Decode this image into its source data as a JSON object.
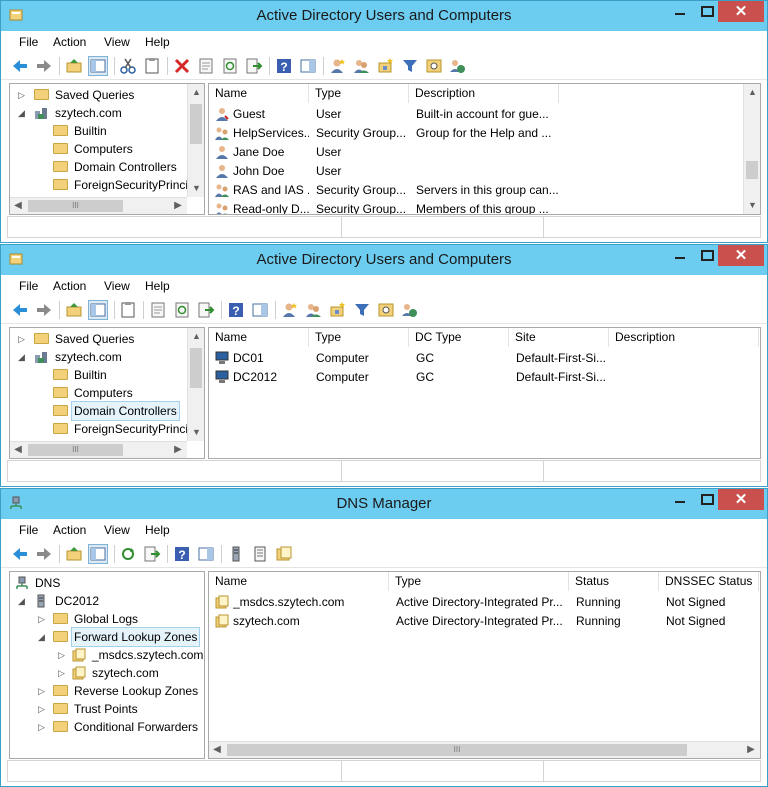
{
  "windows": [
    {
      "title": "Active Directory Users and Computers",
      "menu": [
        "File",
        "Action",
        "View",
        "Help"
      ],
      "tree": [
        {
          "label": "Saved Queries",
          "expander": "▷",
          "level": 1
        },
        {
          "label": "szytech.com",
          "expander": "◢",
          "level": 1
        },
        {
          "label": "Builtin",
          "expander": "",
          "level": 2
        },
        {
          "label": "Computers",
          "expander": "",
          "level": 2
        },
        {
          "label": "Domain Controllers",
          "expander": "",
          "level": 2
        },
        {
          "label": "ForeignSecurityPrinci",
          "expander": "",
          "level": 2
        }
      ],
      "columns": [
        "Name",
        "Type",
        "Description"
      ],
      "rows": [
        [
          "Guest",
          "User",
          "Built-in account for gue..."
        ],
        [
          "HelpServices...",
          "Security Group...",
          "Group for the Help and ..."
        ],
        [
          "Jane Doe",
          "User",
          ""
        ],
        [
          "John Doe",
          "User",
          ""
        ],
        [
          "RAS and IAS ...",
          "Security Group...",
          "Servers in this group can..."
        ],
        [
          "Read-only D...",
          "Security Group...",
          "Members of this group ..."
        ]
      ]
    },
    {
      "title": "Active Directory Users and Computers",
      "menu": [
        "File",
        "Action",
        "View",
        "Help"
      ],
      "tree": [
        {
          "label": "Saved Queries",
          "expander": "▷",
          "level": 1
        },
        {
          "label": "szytech.com",
          "expander": "◢",
          "level": 1
        },
        {
          "label": "Builtin",
          "expander": "",
          "level": 2
        },
        {
          "label": "Computers",
          "expander": "",
          "level": 2
        },
        {
          "label": "Domain Controllers",
          "expander": "",
          "level": 2
        },
        {
          "label": "ForeignSecurityPrinci",
          "expander": "",
          "level": 2
        }
      ],
      "columns": [
        "Name",
        "Type",
        "DC Type",
        "Site",
        "Description"
      ],
      "rows": [
        [
          "DC01",
          "Computer",
          "GC",
          "Default-First-Si...",
          ""
        ],
        [
          "DC2012",
          "Computer",
          "GC",
          "Default-First-Si...",
          ""
        ]
      ]
    },
    {
      "title": "DNS Manager",
      "menu": [
        "File",
        "Action",
        "View",
        "Help"
      ],
      "tree": [
        {
          "label": "DNS",
          "expander": "",
          "level": 0
        },
        {
          "label": "DC2012",
          "expander": "◢",
          "level": 1
        },
        {
          "label": "Global Logs",
          "expander": "▷",
          "level": 2
        },
        {
          "label": "Forward Lookup Zones",
          "expander": "◢",
          "level": 2
        },
        {
          "label": "_msdcs.szytech.com",
          "expander": "▷",
          "level": 3
        },
        {
          "label": "szytech.com",
          "expander": "▷",
          "level": 3
        },
        {
          "label": "Reverse Lookup Zones",
          "expander": "▷",
          "level": 2
        },
        {
          "label": "Trust Points",
          "expander": "▷",
          "level": 2
        },
        {
          "label": "Conditional Forwarders",
          "expander": "▷",
          "level": 2
        }
      ],
      "columns": [
        "Name",
        "Type",
        "Status",
        "DNSSEC Status"
      ],
      "rows": [
        [
          "_msdcs.szytech.com",
          "Active Directory-Integrated Pr...",
          "Running",
          "Not Signed"
        ],
        [
          "szytech.com",
          "Active Directory-Integrated Pr...",
          "Running",
          "Not Signed"
        ]
      ]
    }
  ],
  "scroll": {
    "hthumb": "III",
    "vthumb": "≡"
  },
  "controls": {
    "close": "✕"
  },
  "colors": {
    "titlebar": "#6dcdf0",
    "close": "#c9504d",
    "folder": "#f2d17a",
    "selection": "#e5f3fb"
  }
}
